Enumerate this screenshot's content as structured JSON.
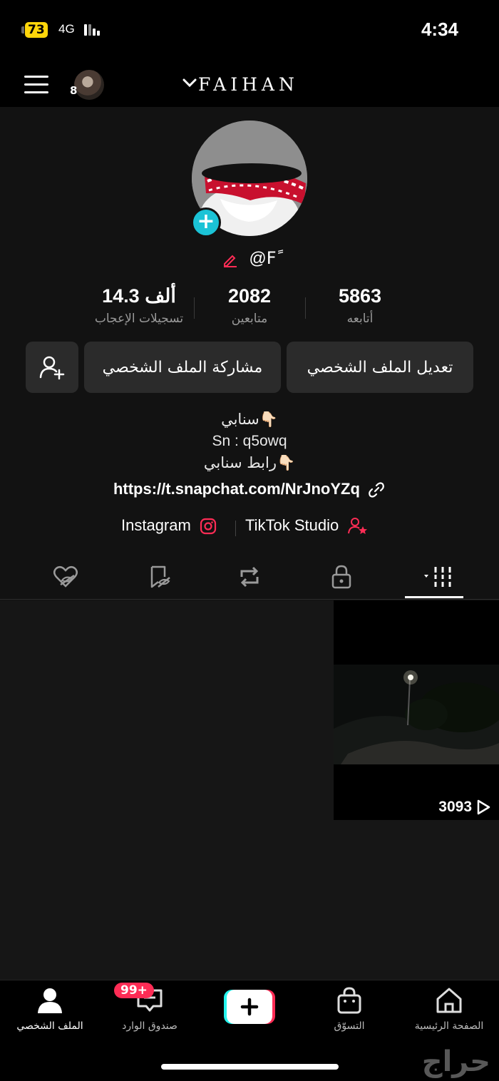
{
  "status_bar": {
    "battery": "73",
    "network": "4G",
    "time": "4:34"
  },
  "header": {
    "username": "FAIHAN",
    "account_badge_count": "8"
  },
  "profile": {
    "handle": "@Fً",
    "stats": [
      {
        "value": "5863",
        "label": "أتابعه"
      },
      {
        "value": "2082",
        "label": "متابعين"
      },
      {
        "value": "14.3 ألف",
        "label": "تسجيلات الإعجاب"
      }
    ],
    "buttons": {
      "edit": "تعديل الملف الشخصي",
      "share": "مشاركة الملف الشخصي"
    },
    "bio": [
      "سنابي👇🏻",
      "Sn : q5owq",
      "رابط سنابي👇🏻"
    ],
    "link": "https://t.snapchat.com/NrJnoYZq",
    "socials": {
      "tiktok_studio": "TikTok Studio",
      "instagram": "Instagram"
    }
  },
  "videos": [
    {
      "views": "3093"
    }
  ],
  "bottom_nav": {
    "home": "الصفحة الرئيسية",
    "shop": "التسوّق",
    "inbox": "صندوق الوارد",
    "inbox_badge": "99+",
    "profile": "الملف الشخصي"
  },
  "watermark": "حراج",
  "colors": {
    "accent": "#fe2c55",
    "cyan": "#25f4ee",
    "badge_cyan": "#1bc3d6",
    "battery": "#ffd60a"
  }
}
